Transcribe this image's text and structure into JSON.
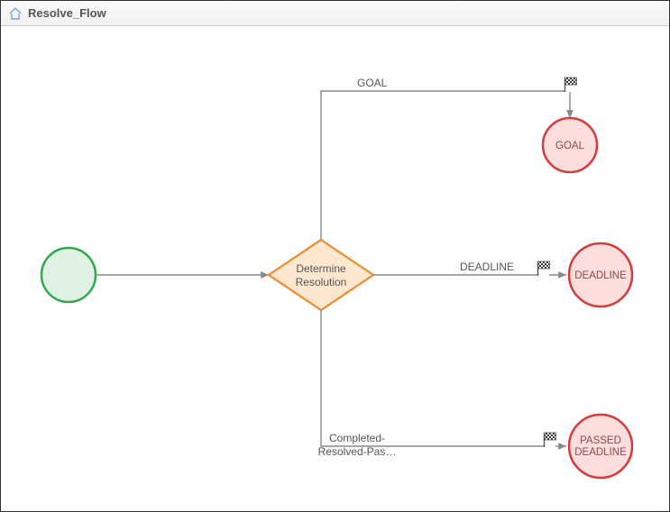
{
  "header": {
    "title": "Resolve_Flow"
  },
  "nodes": {
    "start": {
      "label": ""
    },
    "decision": {
      "line1": "Determine",
      "line2": "Resolution"
    },
    "goal": {
      "label": "GOAL"
    },
    "deadline": {
      "label": "DEADLINE"
    },
    "passed": {
      "line1": "PASSED",
      "line2": "DEADLINE"
    }
  },
  "edges": {
    "to_goal": {
      "label": "GOAL"
    },
    "to_deadline": {
      "label": "DEADLINE"
    },
    "to_passed": {
      "line1": "Completed-",
      "line2": "Resolved-Pas…"
    }
  },
  "chart_data": {
    "type": "flow",
    "title": "Resolve_Flow",
    "nodes": [
      {
        "id": "start",
        "type": "start",
        "label": ""
      },
      {
        "id": "decision",
        "type": "decision",
        "label": "Determine Resolution"
      },
      {
        "id": "goal",
        "type": "end",
        "label": "GOAL"
      },
      {
        "id": "deadline",
        "type": "end",
        "label": "DEADLINE"
      },
      {
        "id": "passed_deadline",
        "type": "end",
        "label": "PASSED DEADLINE"
      }
    ],
    "edges": [
      {
        "from": "start",
        "to": "decision",
        "label": ""
      },
      {
        "from": "decision",
        "to": "goal",
        "label": "GOAL"
      },
      {
        "from": "decision",
        "to": "deadline",
        "label": "DEADLINE"
      },
      {
        "from": "decision",
        "to": "passed_deadline",
        "label": "Completed-Resolved-Pas…"
      }
    ]
  }
}
